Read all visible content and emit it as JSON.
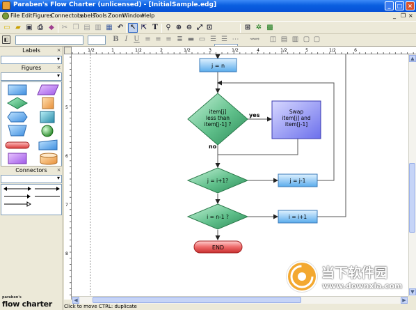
{
  "window": {
    "title": "Paraben's Flow Charter (unlicensed) - [InitialSample.edg]"
  },
  "menu": [
    "File",
    "Edit",
    "Figures",
    "Connectors",
    "Labels",
    "Tools",
    "Zoom",
    "Window",
    "Help"
  ],
  "toolbar": {
    "zoom": "110%"
  },
  "format_bar": {
    "bold": "B",
    "italic": "I",
    "underline": "U"
  },
  "panels": {
    "labels": "Labels",
    "figures": "Figures",
    "connectors": "Connectors"
  },
  "ruler": {
    "top_ticks": [
      "1/2",
      "1",
      "1/2",
      "2",
      "1/2",
      "3",
      "1/2",
      "4",
      "1/2",
      "5",
      "1/2",
      "6"
    ],
    "left_ticks": [
      "5",
      "6",
      "7",
      "8",
      "9"
    ]
  },
  "flowchart": {
    "assign_j": "j = n",
    "decision_compare": "item[j]\nless than\nitem[j-1] ?",
    "swap": "Swap\nitem[j] and\nitem[j-1]",
    "yes": "yes",
    "no": "no",
    "decision_j": "j = i+1?",
    "dec_j": "j = j-1",
    "decision_i": "i = n-1 ?",
    "inc_i": "i = i+1",
    "end": "END"
  },
  "status": {
    "text": "Click to move   CTRL: duplicate"
  },
  "logo": {
    "small": "paraben's",
    "big": "flow charter"
  },
  "watermark": {
    "title": "当下软件园",
    "url": "www.downxia.com"
  },
  "colors": {
    "titlebar": "#0a5fe0",
    "decision": "#3aa36a",
    "process": "#7ec3f2",
    "swap": "#8b8ef5",
    "end": "#e05050"
  }
}
